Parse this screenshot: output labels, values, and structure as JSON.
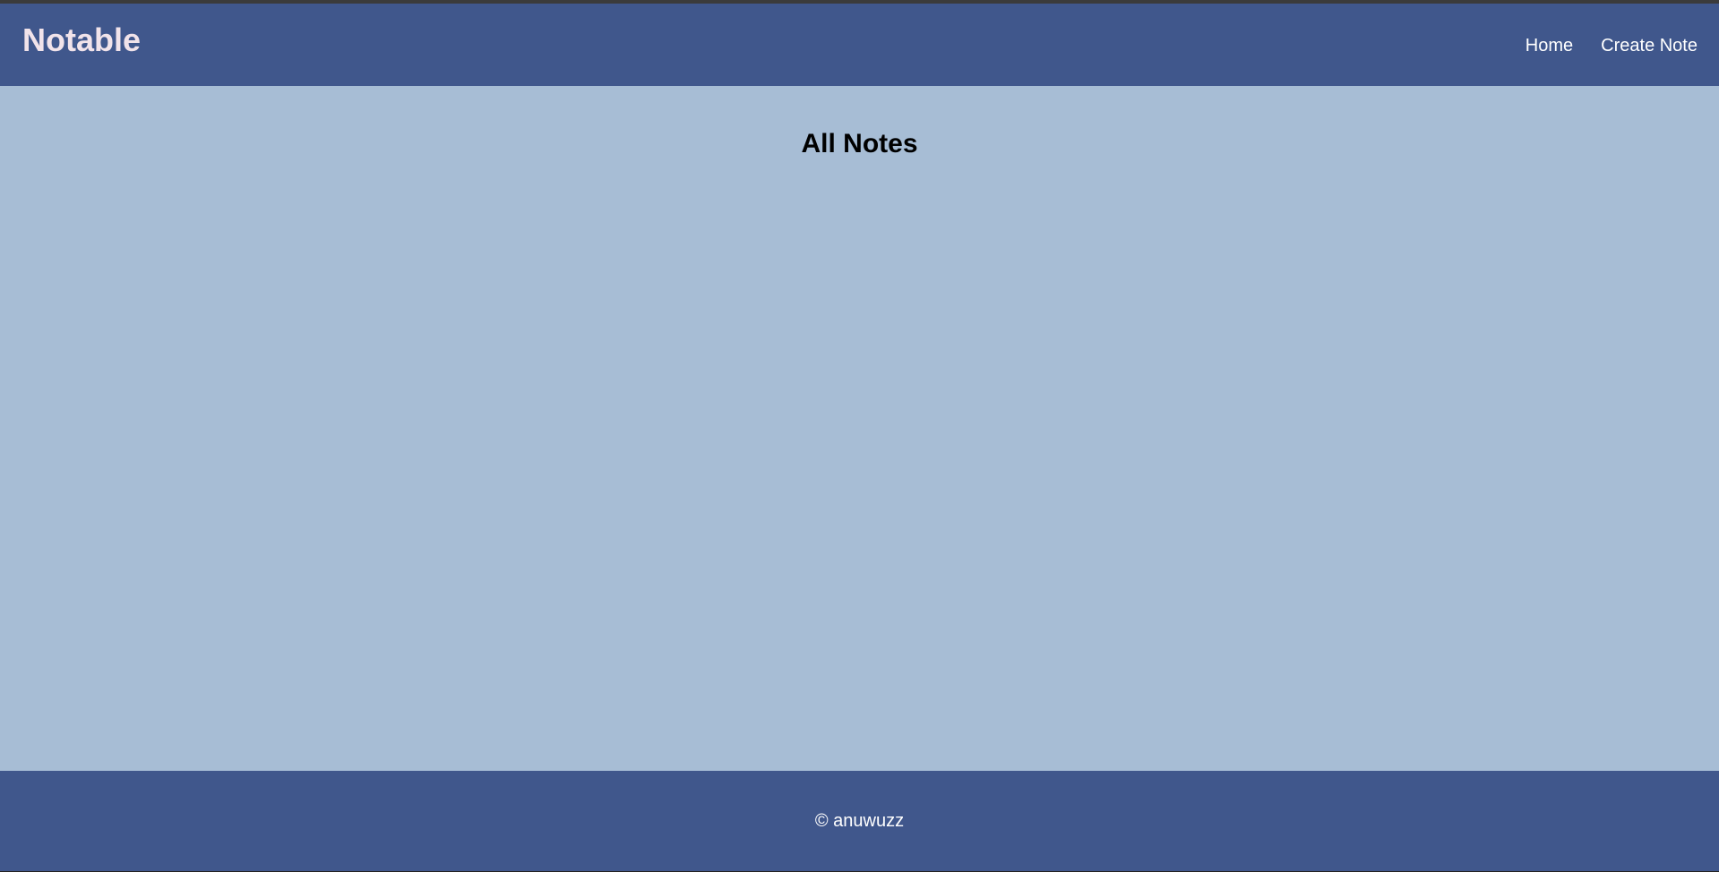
{
  "header": {
    "brand": "Notable",
    "nav": [
      {
        "label": "Home"
      },
      {
        "label": "Create Note"
      }
    ]
  },
  "main": {
    "title": "All Notes",
    "notes": []
  },
  "footer": {
    "text": "© anuwuzz"
  },
  "colors": {
    "navbar_bg": "#40578c",
    "content_bg": "#a7bdd5",
    "brand_text": "#f1e3ea",
    "link_text": "#ffffff"
  }
}
